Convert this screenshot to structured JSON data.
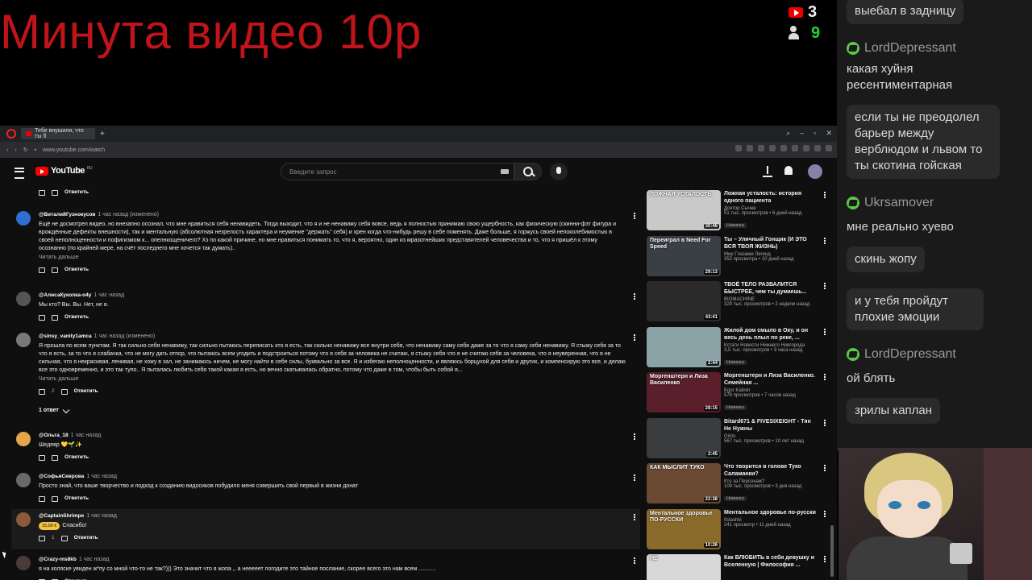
{
  "overlay": {
    "title": "Минута видео 10р"
  },
  "stream_stats": {
    "youtube_count": "3",
    "viewers_count": "9"
  },
  "chat": {
    "messages": [
      {
        "user": "",
        "text": "выебал в задницу"
      },
      {
        "user": "LordDepressant",
        "text": "какая хуйня ресентиментарная"
      },
      {
        "user": "",
        "text": "если ты не преодолел барьер между верблюдом и львом то ты скотина гойская"
      },
      {
        "user": "Ukrsamover",
        "text": "мне реально хуево"
      },
      {
        "user": "",
        "text": "скинь жопу"
      },
      {
        "user": "",
        "text": "и у тебя пройдут плохие эмоции"
      },
      {
        "user": "LordDepressant",
        "text": "ой блять"
      },
      {
        "user": "",
        "text": "зрилы каплан"
      }
    ]
  },
  "browser": {
    "tab_title": "Тебе внушили, что ты б",
    "url": "www.youtube.com/watch"
  },
  "youtube": {
    "logo": "YouTube",
    "region": "RU",
    "search_placeholder": "Введите запрос",
    "reply_label": "Ответить",
    "read_more": "Читать дальше",
    "comments": [
      {
        "author": "@ВиталийГузнокусов",
        "time": "1 час назад (изменено)",
        "text": "Ещё не досмотрел видео, но внезапно осознал, что мне нравиться себя ненавидеть. Тогда выходит, что я и не ненавижу себя вовсе, ведь я полностью принимаю свою ущербность, как физическую (скинни-фэт фигура и врождённые дефекты внешности), так и ментальную (абсолютная незрелость характера и неумение \"держать\" себя) и хрен когда что-нибудь решу в себе поменять. Даже больше, я горжусь своей непоколебимостью в своей неполноценности и пофигизмом к... опелнкощеничего? Хз по какой причине, но мне нравиться понимать то, что я, вероятно, один из мразотнейших представителей человечества и то, что я пришёл к этому осознанно (по крайней мере, на счёт последнего мне хочется так думать)..",
        "likes": "",
        "read_more": true
      },
      {
        "author": "@АлисаКуколка-о4у",
        "time": "1 час назад",
        "text": "Мы кто? Вы. Вы. Нет, не я.",
        "likes": "",
        "read_more": false
      },
      {
        "author": "@sinsy_vanity1amca",
        "time": "1 час назад (изменено)",
        "text": "Я прошла по всем пунктам. Я так сильно себя ненавижу, так сильно пытаюсь переписать кто я есть, так сильно ненавижу все внутри себя, что ненавижу саму себя даже за то что я саму себя ненавижу. Я стыжу себя за то что я есть, за то что я слабачка, что не могу дать отпор, что пытаюсь всем угодить и подстроиться потому что я себя за человека не считаю, я стыжу себя что я не считаю себя за человека, что я неуверенная, что я не сильная, что я некрасивая, ленивая, не хожу в зал, не занимаюсь ничем, не могу найти в себе силы, буквально за все. Я и избегаю неполноценности, и являюсь борцухой для себя и других, и компенсирую это все, и делаю все это одновременно, и это так тупо.. Я пыталась любить себя такой какая я есть, но вечно скатывалась обратно, потому что даже в том, чтобы быть собой я...",
        "likes": "2",
        "read_more": true,
        "replies": "1 ответ"
      },
      {
        "author": "@Ольга_18",
        "time": "1 час назад",
        "text": "Шедевр 💛🌱✨",
        "likes": "",
        "read_more": false
      },
      {
        "author": "@СофьяСеврова",
        "time": "1 час назад",
        "text": "Просто знай, что ваше творчество и подход к созданию видосиков побудило меня совершить свой первый в жизни донат",
        "likes": "",
        "read_more": false
      },
      {
        "author": "@CaptainShrimpe",
        "time": "1 час назад",
        "donation": "15,00 €",
        "text": "Спасибо!",
        "likes": "1",
        "read_more": false
      },
      {
        "author": "@Crazy-ms8kb",
        "time": "1 час назад",
        "text": "я на коляске увиден ж*пу со мной что-то не так?))) Это значит что я жопа ,, а нееееет погодите это тайное послание, скорее всего это нам всем ...........",
        "likes": "",
        "read_more": false
      }
    ],
    "recommendations": [
      {
        "thumb_text": "ЛОЖНАЯ УСТАЛОСТЬ",
        "duration": "30:46",
        "title": "Ложная усталость: история одного пациента",
        "channel": "Доктор Сычев",
        "meta": "51 тыс. просмотров • 6 дней назад",
        "badge": "Новинка",
        "color": "#c9c9c9"
      },
      {
        "thumb_text": "Переиграл в Need For Speed",
        "duration": "29:13",
        "title": "Ты – Уличный Гонщик (И ЭТО ВСЯ ТВОЯ ЖИЗНЬ)",
        "channel": "Мир Глазами Легенд",
        "meta": "352 просмотра • 10 дней назад",
        "badge": "",
        "color": "#3a3f46"
      },
      {
        "thumb_text": "",
        "duration": "43:41",
        "title": "ТВОЁ ТЕЛО РАЗВАЛИТСЯ БЫСТРЕЕ, чем ты думаешь...",
        "channel": "BIOMACHINE",
        "meta": "329 тыс. просмотров • 2 недели назад",
        "badge": "",
        "color": "#2a2a2a"
      },
      {
        "thumb_text": "",
        "duration": "2:44",
        "title": "Жилой дом смыло в Оку, и он весь день плыл по реке, ...",
        "channel": "Кстати Новости Нижнего Новгорода",
        "meta": "3,5 тыс. просмотров • 3 часа назад",
        "badge": "Новинка",
        "color": "#8aa1a6"
      },
      {
        "thumb_text": "Моргенштерн и Лиза Василенко",
        "duration": "28:15",
        "title": "Моргенштерн и Лиза Василенко. Семейная ...",
        "channel": "Egor Kalinin",
        "meta": "578 просмотров • 7 часов назад",
        "badge": "Новинка",
        "color": "#5a1f2a"
      },
      {
        "thumb_text": "",
        "duration": "2:45",
        "title": "Bitard671 & FIVESIXEIGHT - Тян Не Нужны",
        "channel": "Ginto",
        "meta": "567 тыс. просмотров • 10 лет назад",
        "badge": "",
        "color": "#3a3c3e"
      },
      {
        "thumb_text": "КАК МЫСЛИТ ТУКО",
        "duration": "22:38",
        "title": "Что творится в голове Туко Саламанки?",
        "channel": "Кто за Персонаж?",
        "meta": "109 тыс. просмотров • 3 дня назад",
        "badge": "Новинка",
        "color": "#6b4a34"
      },
      {
        "thumb_text": "Ментальное здоровье ПО-РУССКИ",
        "duration": "10:26",
        "title": "Ментальное здоровье по-русски",
        "channel": "fistashki",
        "meta": "241 просмотр • 11 дней назад",
        "badge": "",
        "color": "#8a6a2a"
      },
      {
        "thumb_text": "НЕ",
        "duration": "",
        "title": "Как ВЛЮБИТЬ в себя девушку и Вселенную | Философия ...",
        "channel": "",
        "meta": "",
        "badge": "",
        "color": "#d8d8d8"
      }
    ]
  }
}
